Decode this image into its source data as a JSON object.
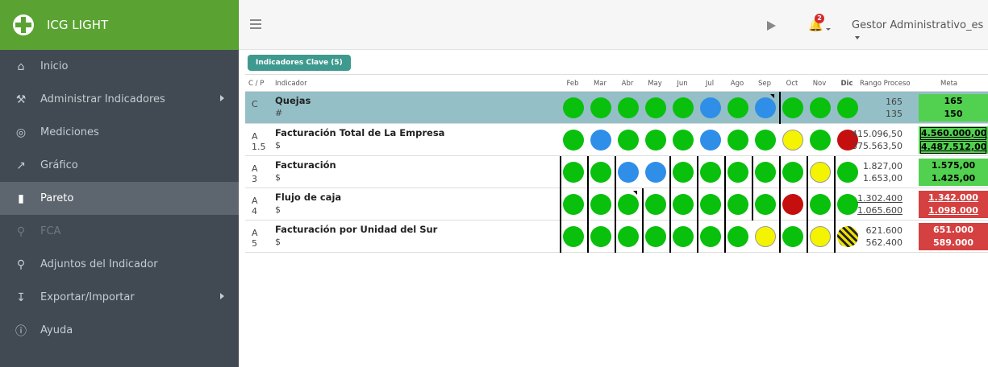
{
  "app": {
    "title": "ICG LIGHT"
  },
  "nav": [
    {
      "label": "Inicio",
      "icon": "home-icon"
    },
    {
      "label": "Administrar Indicadores",
      "icon": "wrench-icon"
    },
    {
      "label": "Mediciones",
      "icon": "target-icon"
    },
    {
      "label": "Gráfico",
      "icon": "line-chart-icon"
    },
    {
      "label": "Pareto",
      "icon": "bar-chart-icon"
    },
    {
      "label": "FCA",
      "icon": "search-icon"
    },
    {
      "label": "Adjuntos del Indicador",
      "icon": "paperclip-icon"
    },
    {
      "label": "Exportar/Importar",
      "icon": "download-icon"
    },
    {
      "label": "Ayuda",
      "icon": "info-icon"
    }
  ],
  "topbar": {
    "user": "Gestor Administrativo_es",
    "notifications": "2"
  },
  "tab": {
    "label": "Indicadores Clave (5)"
  },
  "headers": {
    "cp": "C / P",
    "indicator": "Indicador",
    "months": [
      "Feb",
      "Mar",
      "Abr",
      "May",
      "Jun",
      "Jul",
      "Ago",
      "Sep",
      "Oct",
      "Nov",
      "Dic"
    ],
    "range": "Rango Proceso",
    "meta": "Meta"
  },
  "colors": {
    "green": "#09c00c",
    "blue": "#2f8ee8",
    "yellow": "#f4f400",
    "red": "#c50f0f",
    "sidebar": "#414a52",
    "brand": "#5aa332"
  },
  "rows": [
    {
      "cp1": "C",
      "cp2": "",
      "name": "Quejas",
      "unit": "#",
      "range_hi": "165",
      "range_lo": "135",
      "meta_hi": "165",
      "meta_lo": "150"
    },
    {
      "cp1": "A",
      "cp2": "1.5",
      "name": "Facturación Total de La Empresa",
      "unit": "$",
      "range_hi": "415.096,50",
      "range_lo": "375.563,50",
      "meta_hi": "4.560.000,00",
      "meta_lo": "4.487.512,00"
    },
    {
      "cp1": "A",
      "cp2": "3",
      "name": "Facturación",
      "unit": "$",
      "range_hi": "1.827,00",
      "range_lo": "1.653,00",
      "meta_hi": "1.575,00",
      "meta_lo": "1.425,00"
    },
    {
      "cp1": "A",
      "cp2": "4",
      "name": "Flujo de caja",
      "unit": "$",
      "range_hi": "1.302.400",
      "range_lo": "1.065.600",
      "meta_hi": "1.342.000",
      "meta_lo": "1.098.000"
    },
    {
      "cp1": "A",
      "cp2": "5",
      "name": "Facturación por Unidad del Sur",
      "unit": "$",
      "range_hi": "621.600",
      "range_lo": "562.400",
      "meta_hi": "651.000",
      "meta_lo": "589.000"
    }
  ]
}
